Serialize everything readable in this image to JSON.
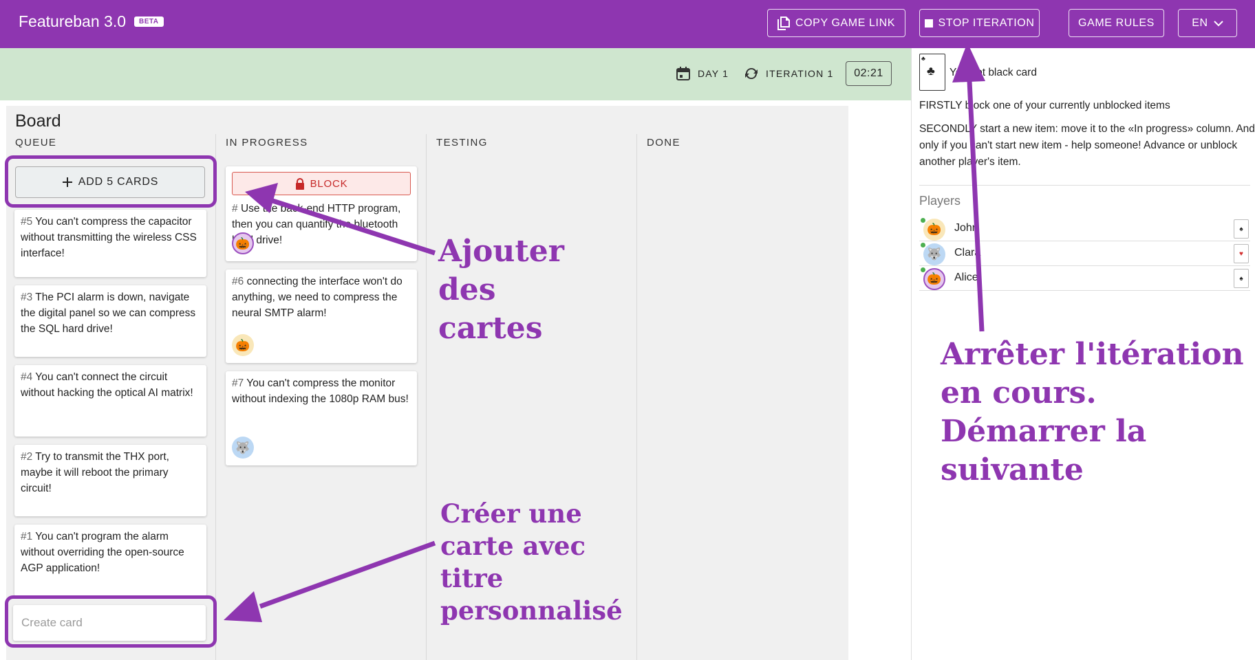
{
  "app": {
    "title": "Featureban 3.0",
    "badge": "BETA"
  },
  "toolbar": {
    "copy_link": "COPY GAME LINK",
    "stop_iteration": "STOP ITERATION",
    "game_rules": "GAME RULES",
    "language": "EN"
  },
  "status": {
    "day": "DAY 1",
    "iteration": "ITERATION 1",
    "timer": "02:21"
  },
  "board": {
    "title": "Board",
    "columns": [
      "QUEUE",
      "IN PROGRESS",
      "TESTING",
      "DONE"
    ],
    "add_cards_label": "ADD 5 CARDS",
    "create_card_placeholder": "Create card",
    "block_label": "BLOCK",
    "queue_cards": [
      {
        "num": "#5",
        "text": "You can't compress the capacitor without transmitting the wireless CSS interface!"
      },
      {
        "num": "#3",
        "text": "The PCI alarm is down, navigate the digital panel so we can compress the SQL hard drive!"
      },
      {
        "num": "#4",
        "text": "You can't connect the circuit without hacking the optical AI matrix!"
      },
      {
        "num": "#2",
        "text": "Try to transmit the THX port, maybe it will reboot the primary circuit!"
      },
      {
        "num": "#1",
        "text": "You can't program the alarm without overriding the open-source AGP application!"
      }
    ],
    "progress_cards": [
      {
        "num": "#",
        "text": "Use the back-end HTTP program, then you can quantify the bluetooth hard drive!"
      },
      {
        "num": "#6",
        "text": "connecting the interface won't do anything, we need to compress the neural SMTP alarm!"
      },
      {
        "num": "#7",
        "text": "You can't compress the monitor without indexing the 1080p RAM bus!"
      }
    ]
  },
  "panel": {
    "card_message": "You got black card",
    "firstly": "FIRSTLY block one of your currently unblocked items",
    "secondly": "SECONDLY start a new item: move it to the «In progress» column. And only if you can't start new item - help someone! Advance or unblock another player's item.",
    "players_title": "Players",
    "players": [
      {
        "name": "John",
        "suit": "♠",
        "avatar": "pumpkin-icon"
      },
      {
        "name": "Clara",
        "suit": "♥",
        "avatar": "wolf-icon"
      },
      {
        "name": "Alice",
        "suit": "♠",
        "avatar": "pumpkin-icon"
      }
    ]
  },
  "annotations": {
    "add_cards": "Ajouter des cartes",
    "stop_iteration": "Arrêter l'itération en cours. Démarrer la suivante",
    "create_card": "Créer une carte avec titre personnalisé"
  },
  "colors": {
    "primary": "#8e36b0",
    "strip": "#cfe6cf",
    "block": "#c62828"
  }
}
